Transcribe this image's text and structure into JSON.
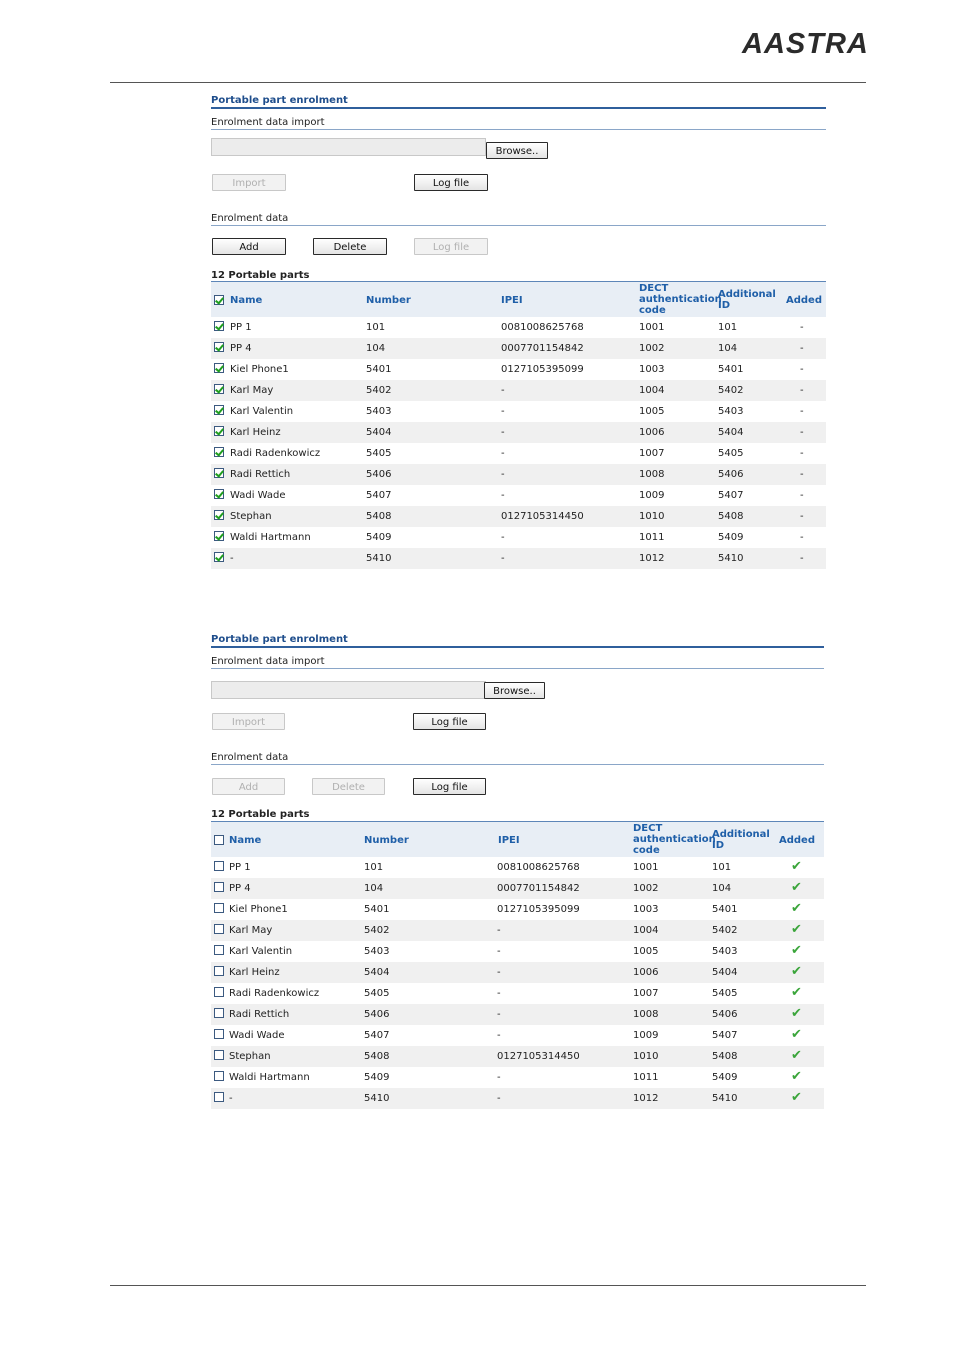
{
  "brand": {
    "logo_text": "AASTRA"
  },
  "panel_a": {
    "title": "Portable part enrolment",
    "import_section": "Enrolment data import",
    "browse_label": "Browse..",
    "import_label": "Import",
    "logfile_label_top": "Log file",
    "enrolment_section": "Enrolment data",
    "add_label": "Add",
    "delete_label": "Delete",
    "logfile_label": "Log file",
    "count_label": "12 Portable parts",
    "headers": {
      "name": "Name",
      "number": "Number",
      "ipei": "IPEI",
      "dect1": "DECT",
      "dect2": "authentication",
      "dect3": "code",
      "add1": "Additional",
      "add2": "ID",
      "added": "Added"
    },
    "rows": [
      {
        "name": "PP 1",
        "number": "101",
        "ipei": "0081008625768",
        "code": "1001",
        "addid": "101",
        "added": "-"
      },
      {
        "name": "PP 4",
        "number": "104",
        "ipei": "0007701154842",
        "code": "1002",
        "addid": "104",
        "added": "-"
      },
      {
        "name": "Kiel Phone1",
        "number": "5401",
        "ipei": "0127105395099",
        "code": "1003",
        "addid": "5401",
        "added": "-"
      },
      {
        "name": "Karl May",
        "number": "5402",
        "ipei": "-",
        "code": "1004",
        "addid": "5402",
        "added": "-"
      },
      {
        "name": "Karl Valentin",
        "number": "5403",
        "ipei": "-",
        "code": "1005",
        "addid": "5403",
        "added": "-"
      },
      {
        "name": "Karl Heinz",
        "number": "5404",
        "ipei": "-",
        "code": "1006",
        "addid": "5404",
        "added": "-"
      },
      {
        "name": "Radi Radenkowicz",
        "number": "5405",
        "ipei": "-",
        "code": "1007",
        "addid": "5405",
        "added": "-"
      },
      {
        "name": "Radi Rettich",
        "number": "5406",
        "ipei": "-",
        "code": "1008",
        "addid": "5406",
        "added": "-"
      },
      {
        "name": "Wadi Wade",
        "number": "5407",
        "ipei": "-",
        "code": "1009",
        "addid": "5407",
        "added": "-"
      },
      {
        "name": "Stephan",
        "number": "5408",
        "ipei": "0127105314450",
        "code": "1010",
        "addid": "5408",
        "added": "-"
      },
      {
        "name": "Waldi Hartmann",
        "number": "5409",
        "ipei": "-",
        "code": "1011",
        "addid": "5409",
        "added": "-"
      },
      {
        "name": "-",
        "number": "5410",
        "ipei": "-",
        "code": "1012",
        "addid": "5410",
        "added": "-"
      }
    ]
  },
  "panel_b": {
    "title": "Portable part enrolment",
    "import_section": "Enrolment data import",
    "browse_label": "Browse..",
    "import_label": "Import",
    "logfile_label_top": "Log file",
    "enrolment_section": "Enrolment data",
    "add_label": "Add",
    "delete_label": "Delete",
    "logfile_label": "Log file",
    "count_label": "12 Portable parts",
    "headers": {
      "name": "Name",
      "number": "Number",
      "ipei": "IPEI",
      "dect1": "DECT",
      "dect2": "authentication",
      "dect3": "code",
      "add1": "Additional",
      "add2": "ID",
      "added": "Added"
    },
    "rows": [
      {
        "name": "PP 1",
        "number": "101",
        "ipei": "0081008625768",
        "code": "1001",
        "addid": "101",
        "added": "✔"
      },
      {
        "name": "PP 4",
        "number": "104",
        "ipei": "0007701154842",
        "code": "1002",
        "addid": "104",
        "added": "✔"
      },
      {
        "name": "Kiel Phone1",
        "number": "5401",
        "ipei": "0127105395099",
        "code": "1003",
        "addid": "5401",
        "added": "✔"
      },
      {
        "name": "Karl May",
        "number": "5402",
        "ipei": "-",
        "code": "1004",
        "addid": "5402",
        "added": "✔"
      },
      {
        "name": "Karl Valentin",
        "number": "5403",
        "ipei": "-",
        "code": "1005",
        "addid": "5403",
        "added": "✔"
      },
      {
        "name": "Karl Heinz",
        "number": "5404",
        "ipei": "-",
        "code": "1006",
        "addid": "5404",
        "added": "✔"
      },
      {
        "name": "Radi Radenkowicz",
        "number": "5405",
        "ipei": "-",
        "code": "1007",
        "addid": "5405",
        "added": "✔"
      },
      {
        "name": "Radi Rettich",
        "number": "5406",
        "ipei": "-",
        "code": "1008",
        "addid": "5406",
        "added": "✔"
      },
      {
        "name": "Wadi Wade",
        "number": "5407",
        "ipei": "-",
        "code": "1009",
        "addid": "5407",
        "added": "✔"
      },
      {
        "name": "Stephan",
        "number": "5408",
        "ipei": "0127105314450",
        "code": "1010",
        "addid": "5408",
        "added": "✔"
      },
      {
        "name": "Waldi Hartmann",
        "number": "5409",
        "ipei": "-",
        "code": "1011",
        "addid": "5409",
        "added": "✔"
      },
      {
        "name": "-",
        "number": "5410",
        "ipei": "-",
        "code": "1012",
        "addid": "5410",
        "added": "✔"
      }
    ]
  },
  "colors": {
    "accent": "#1f5fa8",
    "check": "#3aa53a"
  }
}
